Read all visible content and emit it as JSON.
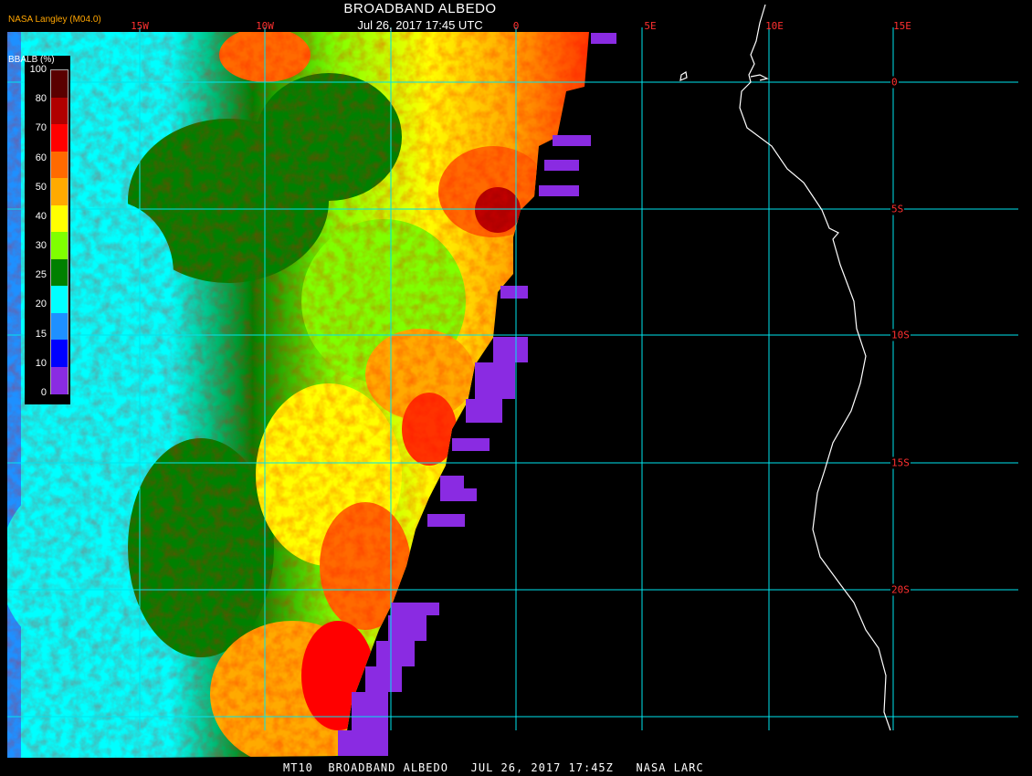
{
  "header": {
    "title": "BROADBAND ALBEDO",
    "datetime": "Jul 26, 2017 17:45 UTC",
    "source": "NASA Langley (M04.0)"
  },
  "footer": "MT10  BROADBAND ALBEDO   JUL 26, 2017 17:45Z   NASA LARC",
  "grid": {
    "longitudes": [
      "15W",
      "10W",
      "5W",
      "0",
      "5E",
      "10E",
      "15E"
    ],
    "latitudes": [
      "0",
      "5S",
      "10S",
      "15S",
      "20S"
    ],
    "line_color": "#00e5ee",
    "label_color": "#ff3030"
  },
  "legend": {
    "title": "BBALB (%)",
    "ticks": [
      "100",
      "80",
      "70",
      "60",
      "50",
      "40",
      "30",
      "25",
      "20",
      "15",
      "10",
      "0"
    ],
    "colors": [
      "#5a0000",
      "#b00000",
      "#ff0000",
      "#ff6a00",
      "#ffaa00",
      "#ffff00",
      "#7fff00",
      "#008000",
      "#00ffff",
      "#1e90ff",
      "#0000ff",
      "#8a2be2"
    ]
  },
  "map": {
    "coastline_color": "#ffffff",
    "no_data_color": "#8a2be2",
    "background_color": "#000000"
  }
}
